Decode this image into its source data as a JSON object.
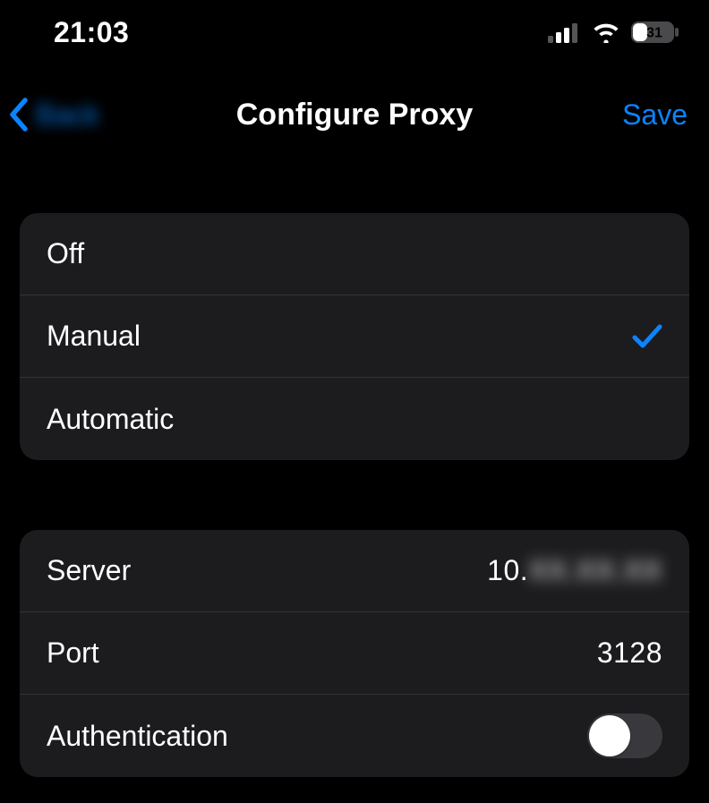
{
  "status_bar": {
    "time": "21:03",
    "battery_percent": "31",
    "cellular_bars": 2,
    "wifi": true
  },
  "nav": {
    "back_label": "Back",
    "title": "Configure Proxy",
    "action_label": "Save"
  },
  "proxy_modes": {
    "options": [
      {
        "label": "Off",
        "selected": false
      },
      {
        "label": "Manual",
        "selected": true
      },
      {
        "label": "Automatic",
        "selected": false
      }
    ]
  },
  "proxy_settings": {
    "server_label": "Server",
    "server_value_prefix": "10.",
    "server_value_blurred": "XX.XX.XX",
    "port_label": "Port",
    "port_value": "3128",
    "auth_label": "Authentication",
    "auth_on": false
  }
}
